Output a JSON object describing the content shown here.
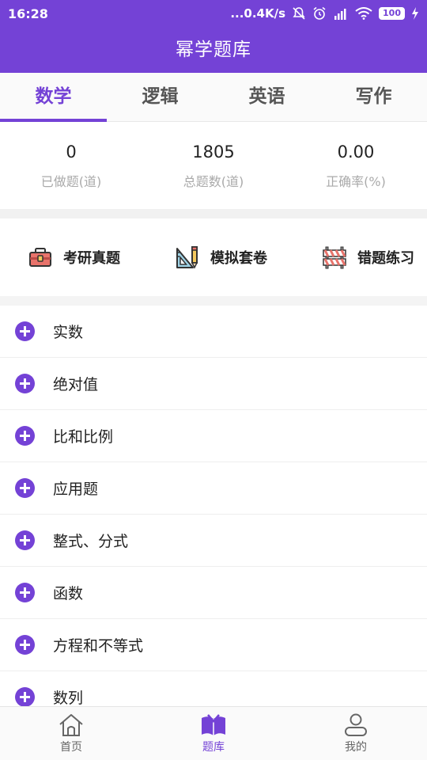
{
  "status_bar": {
    "time": "16:28",
    "network_speed": "...0.4K/s",
    "battery": "100"
  },
  "header": {
    "title": "幂学题库"
  },
  "tabs": [
    {
      "label": "数学",
      "active": true
    },
    {
      "label": "逻辑",
      "active": false
    },
    {
      "label": "英语",
      "active": false
    },
    {
      "label": "写作",
      "active": false
    }
  ],
  "stats": [
    {
      "value": "0",
      "label": "已做题(道)"
    },
    {
      "value": "1805",
      "label": "总题数(道)"
    },
    {
      "value": "0.00",
      "label": "正确率(%)"
    }
  ],
  "actions": [
    {
      "label": "考研真题",
      "icon": "toolbox-icon"
    },
    {
      "label": "模拟套卷",
      "icon": "ruler-pencil-icon"
    },
    {
      "label": "错题练习",
      "icon": "barrier-icon"
    }
  ],
  "topics": [
    "实数",
    "绝对值",
    "比和比例",
    "应用题",
    "整式、分式",
    "函数",
    "方程和不等式",
    "数列"
  ],
  "bottom_nav": [
    {
      "label": "首页",
      "icon": "home-icon"
    },
    {
      "label": "题库",
      "icon": "book-icon",
      "active": true
    },
    {
      "label": "我的",
      "icon": "user-icon"
    }
  ],
  "colors": {
    "accent": "#7442d6",
    "background": "#f4f4f4"
  }
}
